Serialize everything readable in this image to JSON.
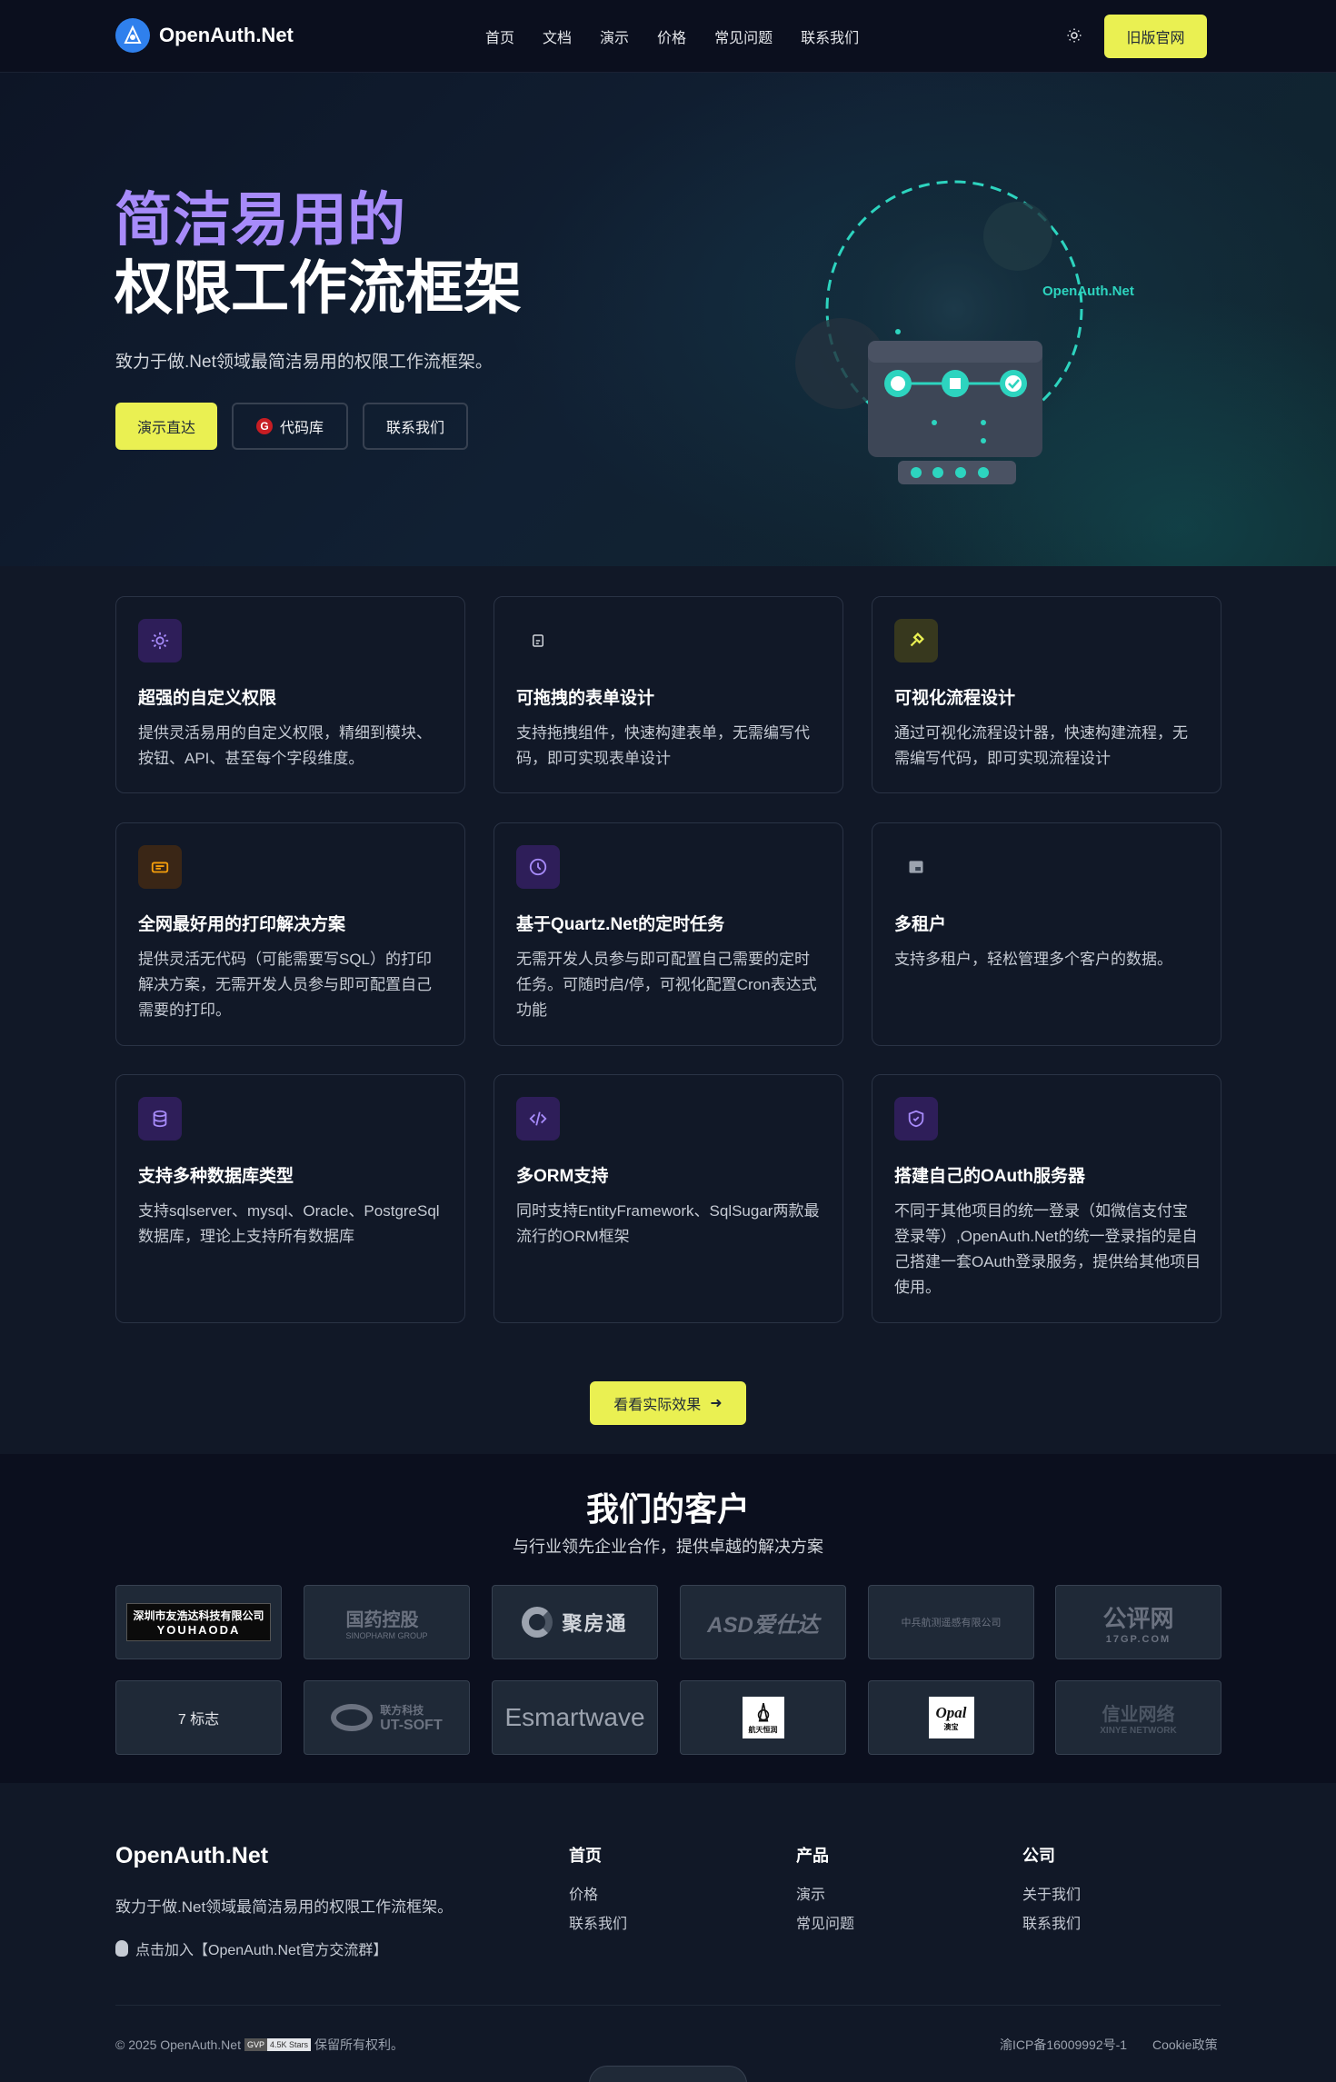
{
  "brand": {
    "name": "OpenAuth.Net"
  },
  "nav": {
    "links": [
      "首页",
      "文档",
      "演示",
      "价格",
      "常见问题",
      "联系我们"
    ],
    "old_site_label": "旧版官网"
  },
  "hero": {
    "title_line1": "简洁易用的",
    "title_line2": "权限工作流框架",
    "subtitle": "致力于做.Net领域最简洁易用的权限工作流框架。",
    "btn_demo": "演示直达",
    "btn_code": "代码库",
    "btn_contact": "联系我们",
    "illustration_label": "OpenAuth.Net",
    "colors": {
      "title_accent": "#a78bfa",
      "primary_button": "#eaf052",
      "illustration_accent": "#2dd4bf"
    }
  },
  "features": [
    {
      "icon": "gear-icon",
      "title": "超强的自定义权限",
      "desc": "提供灵活易用的自定义权限，精细到模块、按钮、API、甚至每个字段维度。"
    },
    {
      "icon": "form-icon",
      "title": "可拖拽的表单设计",
      "desc": "支持拖拽组件，快速构建表单，无需编写代码，即可实现表单设计"
    },
    {
      "icon": "flow-icon",
      "title": "可视化流程设计",
      "desc": "通过可视化流程设计器，快速构建流程，无需编写代码，即可实现流程设计"
    },
    {
      "icon": "printer-icon",
      "title": "全网最好用的打印解决方案",
      "desc": "提供灵活无代码（可能需要写SQL）的打印解决方案，无需开发人员参与即可配置自己需要的打印。"
    },
    {
      "icon": "clock-icon",
      "title": "基于Quartz.Net的定时任务",
      "desc": "无需开发人员参与即可配置自己需要的定时任务。可随时启/停，可视化配置Cron表达式功能"
    },
    {
      "icon": "tenant-icon",
      "title": "多租户",
      "desc": "支持多租户，轻松管理多个客户的数据。"
    },
    {
      "icon": "database-icon",
      "title": "支持多种数据库类型",
      "desc": "支持sqlserver、mysql、Oracle、PostgreSql数据库，理论上支持所有数据库"
    },
    {
      "icon": "code-icon",
      "title": "多ORM支持",
      "desc": "同时支持EntityFramework、SqlSugar两款最流行的ORM框架"
    },
    {
      "icon": "shield-icon",
      "title": "搭建自己的OAuth服务器",
      "desc": "不同于其他项目的统一登录（如微信支付宝登录等）,OpenAuth.Net的统一登录指的是自己搭建一套OAuth登录服务，提供给其他项目使用。"
    }
  ],
  "cta": {
    "label": "看看实际效果"
  },
  "customers": {
    "title": "我们的客户",
    "subtitle": "与行业领先企业合作，提供卓越的解决方案",
    "logos": [
      {
        "name": "深圳市友浩达科技有限公司",
        "sub": "YOUHAODA"
      },
      {
        "name": "国药控股",
        "sub": "SINOPHARM GROUP"
      },
      {
        "name": "聚房通",
        "sub": ""
      },
      {
        "name": "ASD爱仕达",
        "sub": ""
      },
      {
        "name": "中兵航测遥感有限公司",
        "sub": ""
      },
      {
        "name": "公评网",
        "sub": "17GP.COM"
      },
      {
        "name": "7 标志",
        "sub": ""
      },
      {
        "name": "联方科技",
        "sub": "UT-SOFT"
      },
      {
        "name": "Esmartwave",
        "sub": ""
      },
      {
        "name": "航天恒润",
        "sub": ""
      },
      {
        "name": "Opal",
        "sub": "澳宝"
      },
      {
        "name": "信业网络",
        "sub": "XINYE NETWORK"
      }
    ]
  },
  "footer": {
    "brand": "OpenAuth.Net",
    "desc": "致力于做.Net领域最简洁易用的权限工作流框架。",
    "group_link": "点击加入【OpenAuth.Net官方交流群】",
    "columns": [
      {
        "title": "首页",
        "links": [
          "价格",
          "联系我们"
        ]
      },
      {
        "title": "产品",
        "links": [
          "演示",
          "常见问题"
        ]
      },
      {
        "title": "公司",
        "links": [
          "关于我们",
          "联系我们"
        ]
      }
    ],
    "copyright_prefix": "© 2025 OpenAuth.Net",
    "badge_left": "GVP",
    "badge_right": "4.5K Stars",
    "copyright_suffix": "保留所有权利。",
    "icp": "渝ICP备16009992号-1",
    "cookie": "Cookie政策"
  }
}
